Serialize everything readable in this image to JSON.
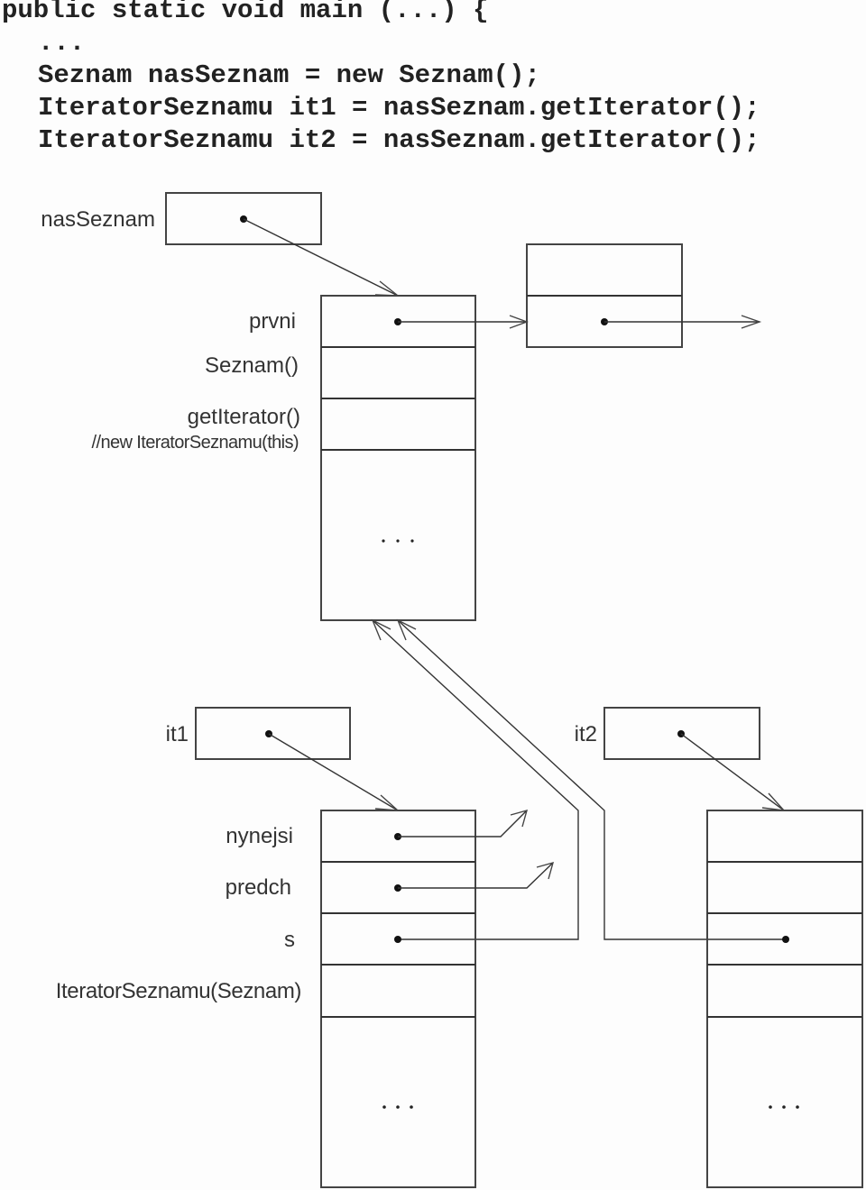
{
  "code": {
    "lines": [
      "public static void main (...) {",
      "...",
      "Seznam nasSeznam = new Seznam();",
      "IteratorSeznamu it1 = nasSeznam.getIterator();",
      "IteratorSeznamu it2 = nasSeznam.getIterator();"
    ]
  },
  "diagram": {
    "variables": {
      "nasSeznam": "nasSeznam",
      "it1": "it1",
      "it2": "it2"
    },
    "seznam_object": {
      "fields": [
        "prvni",
        "Seznam()",
        "getIterator()"
      ],
      "comment": "//new IteratorSeznamu(this)",
      "ellipsis": ". . ."
    },
    "iterator_object": {
      "fields": [
        "nynejsi",
        "predch",
        "s",
        "IteratorSeznamu(Seznam)"
      ],
      "ellipsis": ". . ."
    }
  }
}
